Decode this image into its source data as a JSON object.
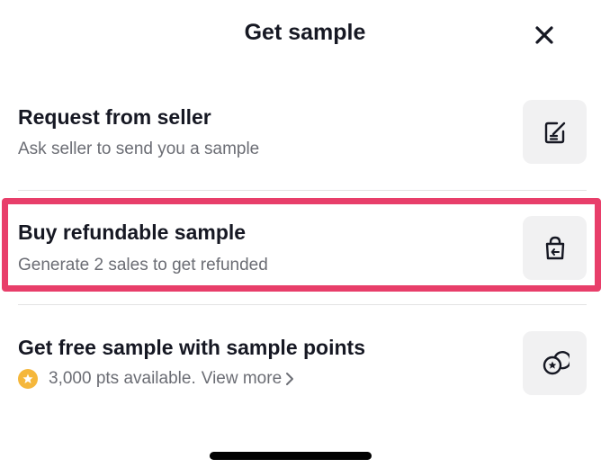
{
  "header": {
    "title": "Get sample"
  },
  "options": [
    {
      "title": "Request from seller",
      "subtitle": "Ask seller to send you a sample"
    },
    {
      "title": "Buy refundable sample",
      "subtitle": "Generate 2 sales to get refunded"
    },
    {
      "title": "Get free sample with sample points",
      "points_text": "3,000 pts available.",
      "view_more": "View more"
    }
  ],
  "colors": {
    "highlight": "#e83e6a",
    "coin": "#f5b73b",
    "icon_bg": "#f1f1f2"
  },
  "icons": [
    "close-icon",
    "note-edit-icon",
    "bag-return-icon",
    "sample-points-icon",
    "points-coin-icon",
    "chevron-right-icon"
  ]
}
